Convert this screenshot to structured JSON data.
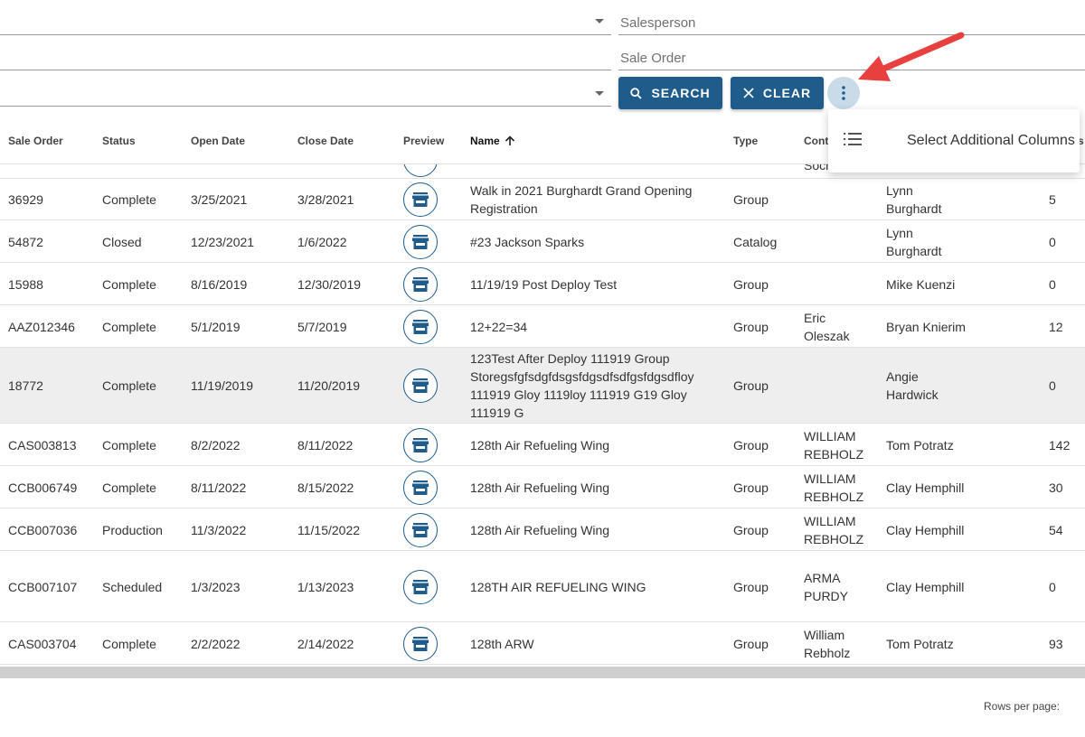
{
  "filters": {
    "salesperson_label": "Salesperson",
    "sale_order_label": "Sale Order"
  },
  "buttons": {
    "search_label": "SEARCH",
    "clear_label": "CLEAR"
  },
  "menu": {
    "icon": "list-icon",
    "item_label": "Select Additional Columns"
  },
  "table": {
    "headers": {
      "sale_order": "Sale Order",
      "status": "Status",
      "open_date": "Open Date",
      "close_date": "Close Date",
      "preview": "Preview",
      "name": "Name",
      "type": "Type",
      "contact": "Cont",
      "last": "s"
    },
    "partial_top_contact": "Soch",
    "rows": [
      {
        "so": "36929",
        "status": "Complete",
        "open": "3/25/2021",
        "close": "3/28/2021",
        "name": "Walk in 2021 Burghardt Grand Opening Registration",
        "type": "Group",
        "contact": "",
        "sales": "Lynn Burghardt",
        "qty": "5"
      },
      {
        "so": "54872",
        "status": "Closed",
        "open": "12/23/2021",
        "close": "1/6/2022",
        "name": "#23 Jackson Sparks",
        "type": "Catalog",
        "contact": "",
        "sales": "Lynn Burghardt",
        "qty": "0"
      },
      {
        "so": "15988",
        "status": "Complete",
        "open": "8/16/2019",
        "close": "12/30/2019",
        "name": "11/19/19 Post Deploy Test",
        "type": "Group",
        "contact": "",
        "sales": "Mike Kuenzi",
        "qty": "0"
      },
      {
        "so": "AAZ012346",
        "status": "Complete",
        "open": "5/1/2019",
        "close": "5/7/2019",
        "name": "12+22=34",
        "type": "Group",
        "contact": "Eric Oleszak",
        "sales": "Bryan Knierim",
        "qty": "12"
      },
      {
        "so": "18772",
        "status": "Complete",
        "open": "11/19/2019",
        "close": "11/20/2019",
        "name": "123Test After Deploy 111919 Group Storegsfgfsdgfdsgsfdgsdfsdfgsfdgsdfloy 111919 Gloy 1119loy 111919 G19 Gloy 111919 G",
        "type": "Group",
        "contact": "",
        "sales": "Angie Hardwick",
        "qty": "0"
      },
      {
        "so": "CAS003813",
        "status": "Complete",
        "open": "8/2/2022",
        "close": "8/11/2022",
        "name": "128th Air Refueling Wing",
        "type": "Group",
        "contact": "WILLIAM REBHOLZ",
        "sales": "Tom Potratz",
        "qty": "142"
      },
      {
        "so": "CCB006749",
        "status": "Complete",
        "open": "8/11/2022",
        "close": "8/15/2022",
        "name": "128th Air Refueling Wing",
        "type": "Group",
        "contact": "WILLIAM REBHOLZ",
        "sales": "Clay Hemphill",
        "qty": "30"
      },
      {
        "so": "CCB007036",
        "status": "Production",
        "open": "11/3/2022",
        "close": "11/15/2022",
        "name": "128th Air Refueling Wing",
        "type": "Group",
        "contact": "WILLIAM REBHOLZ",
        "sales": "Clay Hemphill",
        "qty": "54"
      },
      {
        "so": "CCB007107",
        "status": "Scheduled",
        "open": "1/3/2023",
        "close": "1/13/2023",
        "name": "128TH AIR REFUELING WING",
        "type": "Group",
        "contact": "ARMA PURDY",
        "sales": "Clay Hemphill",
        "qty": "0"
      },
      {
        "so": "CAS003704",
        "status": "Complete",
        "open": "2/2/2022",
        "close": "2/14/2022",
        "name": "128th ARW",
        "type": "Group",
        "contact": "William Rebholz",
        "sales": "Tom Potratz",
        "qty": "93"
      }
    ]
  },
  "footer": {
    "rows_per_page_label": "Rows per page:"
  },
  "colors": {
    "primary": "#1f5c8c",
    "annotation_arrow": "#e8403e",
    "highlight_row": "#eeeeee"
  }
}
